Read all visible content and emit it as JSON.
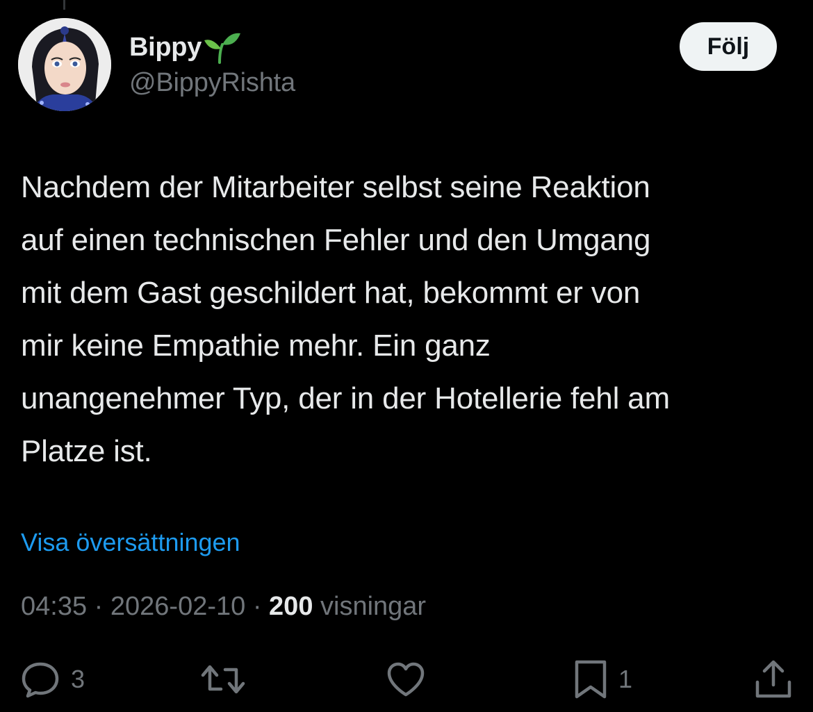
{
  "author": {
    "display_name": "Bippy",
    "name_emoji": "seedling-icon",
    "handle": "@BippyRishta"
  },
  "follow_button": {
    "label": "Följ"
  },
  "tweet": {
    "lines": [
      "Nachdem der Mitarbeiter selbst seine Reaktion",
      "auf einen technischen Fehler und den Umgang",
      "mit dem Gast geschildert hat, bekommt er von",
      "mir keine Empathie mehr. Ein ganz",
      "unangenehmer Typ, der in der Hotellerie fehl am",
      "Platze ist."
    ]
  },
  "translate_link": "Visa översättningen",
  "meta": {
    "time": "04:35",
    "separator": "·",
    "date": "2026-02-10",
    "views_count": "200",
    "views_label": "visningar"
  },
  "actions": {
    "reply": {
      "icon": "reply-icon",
      "count": "3"
    },
    "repost": {
      "icon": "repost-icon",
      "count": ""
    },
    "like": {
      "icon": "heart-icon",
      "count": ""
    },
    "bookmark": {
      "icon": "bookmark-icon",
      "count": "1"
    },
    "share": {
      "icon": "share-icon",
      "count": ""
    }
  },
  "colors": {
    "background": "#000000",
    "primary_text": "#e7e9ea",
    "secondary_text": "#71767b",
    "link": "#1d9bf0",
    "follow_bg": "#eff3f4"
  }
}
